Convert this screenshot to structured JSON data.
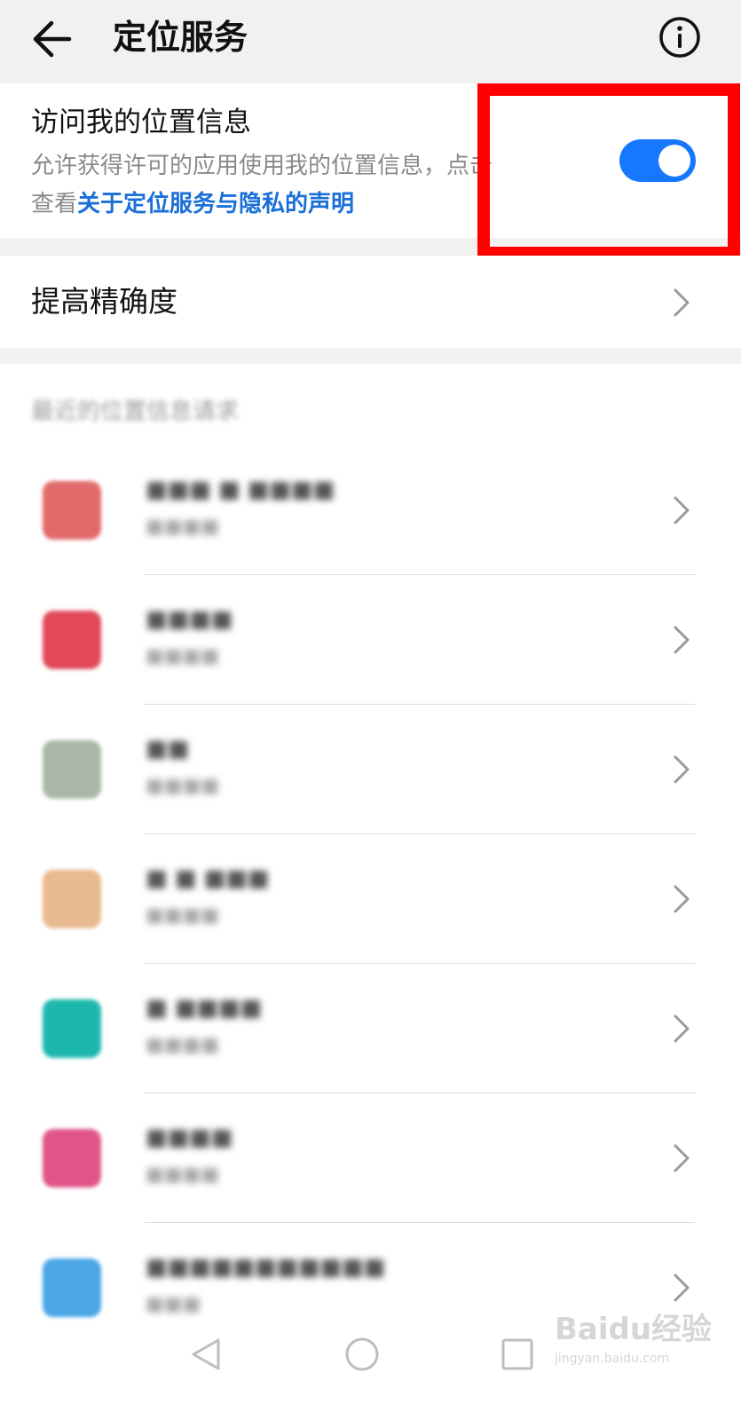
{
  "header": {
    "title": "定位服务",
    "back_icon": "arrow-left-icon",
    "info_icon": "info-circle-icon"
  },
  "location_access": {
    "title": "访问我的位置信息",
    "description": "允许获得许可的应用使用我的位置信息，点击查看",
    "description_line1": "允许获得许可的应用使用我的位置信息，点击",
    "description_line2_prefix": "查看",
    "link_text": "关于定位服务与隐私的声明",
    "toggle_on": true,
    "toggle_color": "#1677ff",
    "link_color": "#1a6fd8"
  },
  "accuracy": {
    "label": "提高精确度"
  },
  "recent": {
    "header": "最近的位置信息请求",
    "apps": [
      {
        "name": "■■■ ■ ■■■■",
        "sub": "■■■■",
        "icon_color": "#e36a6a"
      },
      {
        "name": "■■■■",
        "sub": "■■■■",
        "icon_color": "#e24a5a"
      },
      {
        "name": "■■",
        "sub": "■■■■",
        "icon_color": "#a9b8a6"
      },
      {
        "name": "■ ■ ■■■",
        "sub": "■■■■",
        "icon_color": "#e9b98f"
      },
      {
        "name": "■ ■■■■",
        "sub": "■■■■",
        "icon_color": "#1db8ad"
      },
      {
        "name": "■■■■",
        "sub": "■■■■",
        "icon_color": "#e0558a"
      },
      {
        "name": "■■■■■■■■■■■",
        "sub": "■■■",
        "icon_color": "#4aa6e6"
      }
    ]
  },
  "nav": {
    "back_icon": "nav-back-triangle-icon",
    "home_icon": "nav-home-circle-icon",
    "recent_icon": "nav-recent-square-icon"
  },
  "watermark": {
    "main": "Baidu经验",
    "sub": "jingyan.baidu.com"
  },
  "annotation_color": "#ff0000"
}
